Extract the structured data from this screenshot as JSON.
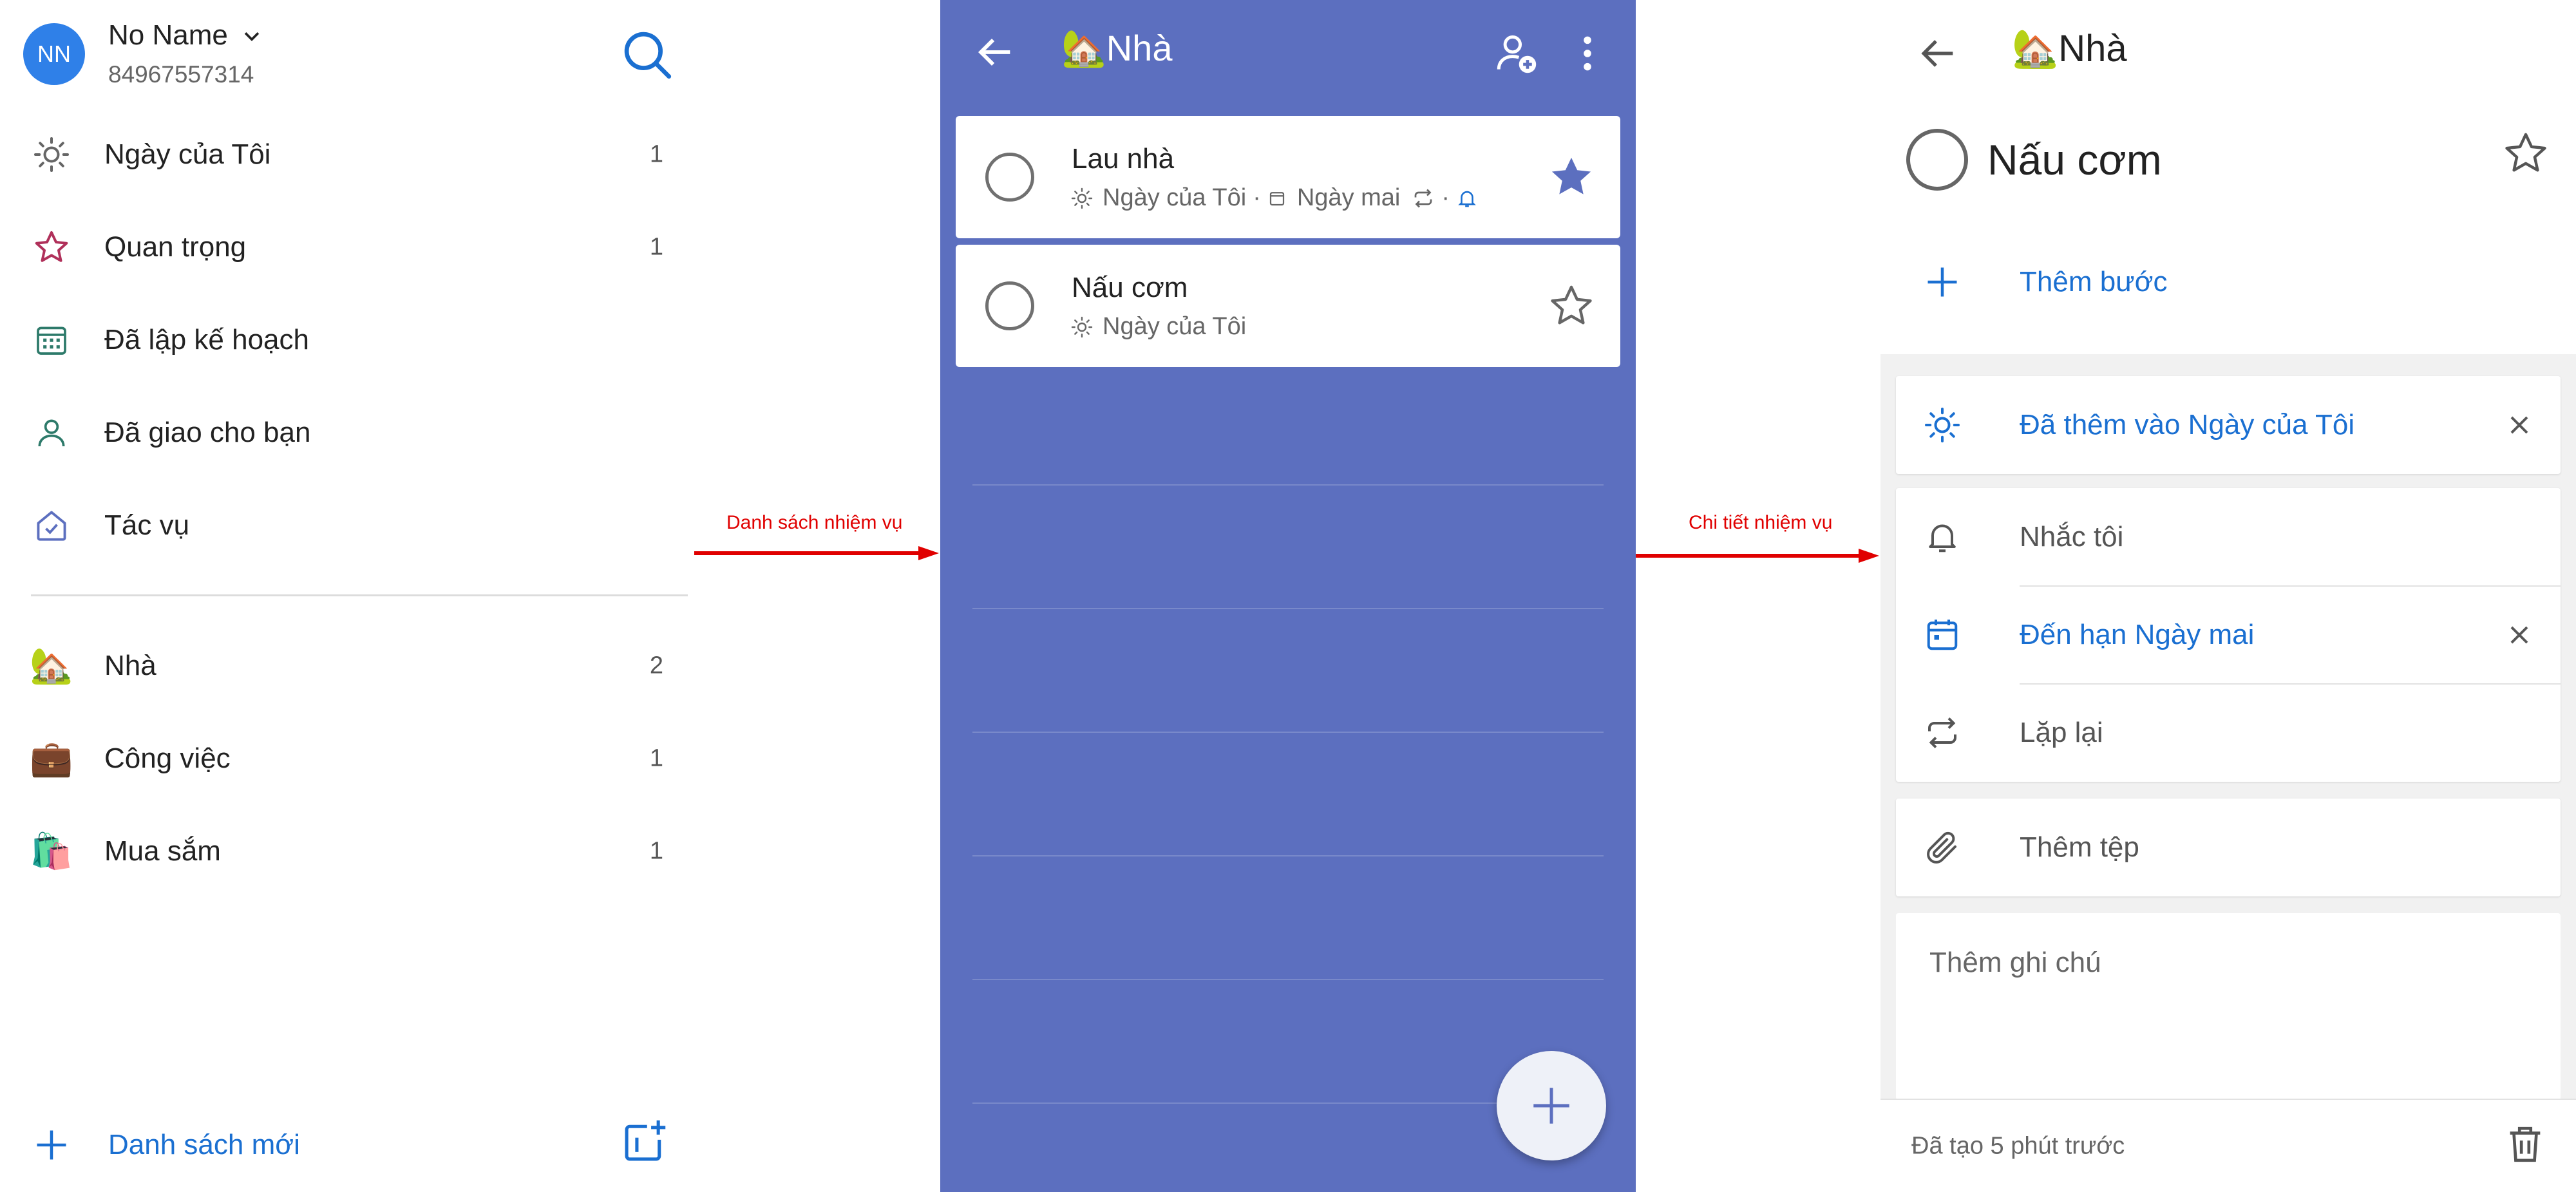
{
  "account": {
    "avatar_initials": "NN",
    "name": "No Name",
    "phone": "84967557314"
  },
  "nav": {
    "smart_lists": [
      {
        "label": "Ngày của Tôi",
        "count": "1",
        "icon": "sun-icon"
      },
      {
        "label": "Quan trọng",
        "count": "1",
        "icon": "star-icon"
      },
      {
        "label": "Đã lập kế hoạch",
        "count": "",
        "icon": "calendar-icon"
      },
      {
        "label": "Đã giao cho bạn",
        "count": "",
        "icon": "person-icon"
      },
      {
        "label": "Tác vụ",
        "count": "",
        "icon": "home-check-icon"
      }
    ],
    "custom_lists": [
      {
        "label": "Nhà",
        "count": "2",
        "emoji": "🏡"
      },
      {
        "label": "Công việc",
        "count": "1",
        "emoji": "💼"
      },
      {
        "label": "Mua sắm",
        "count": "1",
        "emoji": "🛍️"
      }
    ],
    "new_list_label": "Danh sách mới"
  },
  "annotations": {
    "arrow1_label": "Danh sách nhiệm vụ",
    "arrow2_label": "Chi tiết nhiệm vụ"
  },
  "list_view": {
    "emoji": "🏡",
    "title": "Nhà",
    "tasks": [
      {
        "title": "Lau nhà",
        "important": true,
        "meta_myday": "Ngày của Tôi",
        "meta_due": "Ngày mai"
      },
      {
        "title": "Nấu cơm",
        "important": false,
        "meta_myday": "Ngày của Tôi"
      }
    ]
  },
  "detail_view": {
    "emoji": "🏡",
    "list_title": "Nhà",
    "task_title": "Nấu cơm",
    "add_step_label": "Thêm bước",
    "added_to_myday_label": "Đã thêm vào Ngày của Tôi",
    "remind_label": "Nhắc tôi",
    "due_label": "Đến hạn Ngày mai",
    "repeat_label": "Lặp lại",
    "attach_label": "Thêm tệp",
    "note_placeholder": "Thêm ghi chú",
    "created_text": "Đã tạo 5 phút trước"
  },
  "colors": {
    "accent_blue": "#1a6fd1",
    "list_theme": "#5c6fbf",
    "important_star": "#5c6fbf",
    "avatar": "#2f80e8",
    "annotation_red": "#e00000",
    "nav_star": "#b0305a",
    "nav_calendar": "#2d7a6a",
    "nav_person": "#2d7a6a",
    "nav_tasks": "#5c6fbf"
  }
}
